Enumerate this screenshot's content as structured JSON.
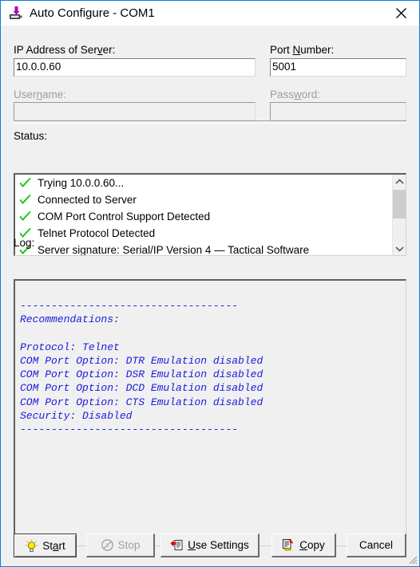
{
  "window": {
    "title": "Auto Configure - COM1",
    "title_icon": "serial-port-download-icon",
    "close_icon": "close-icon",
    "accent_color": "#0a7cd4",
    "background_color": "#f0f0f0"
  },
  "form": {
    "ip_label_before": "IP Address of Ser",
    "ip_label_accel": "v",
    "ip_label_after": "er:",
    "ip_value": "10.0.0.60",
    "port_label_before": "Port ",
    "port_label_accel": "N",
    "port_label_after": "umber:",
    "port_value": "5001",
    "username_label_before": "User",
    "username_label_accel": "n",
    "username_label_after": "ame:",
    "username_value": "",
    "password_label_before": "Pass",
    "password_label_accel": "w",
    "password_label_after": "ord:",
    "password_value": ""
  },
  "status": {
    "label": "Status:",
    "items": [
      {
        "icon": "green-check-icon",
        "text": "Trying 10.0.0.60..."
      },
      {
        "icon": "green-check-icon",
        "text": "Connected to Server"
      },
      {
        "icon": "green-check-icon",
        "text": "COM Port Control Support Detected"
      },
      {
        "icon": "green-check-icon",
        "text": "Telnet Protocol Detected"
      },
      {
        "icon": "green-check-icon",
        "text": "Server signature: Serial/IP Version 4 — Tactical Software"
      }
    ],
    "scroll_up_icon": "chevron-up-icon",
    "scroll_down_icon": "chevron-down-icon"
  },
  "log": {
    "label": "Log:",
    "text_color": "#1a1ae0",
    "lines": [
      "",
      "-----------------------------------",
      "Recommendations:",
      "",
      "Protocol: Telnet",
      "COM Port Option: DTR Emulation disabled",
      "COM Port Option: DSR Emulation disabled",
      "COM Port Option: DCD Emulation disabled",
      "COM Port Option: CTS Emulation disabled",
      "Security: Disabled",
      "-----------------------------------"
    ]
  },
  "buttons": {
    "start": {
      "label_before": "St",
      "label_accel": "a",
      "label_after": "rt",
      "icon": "lightbulb-icon",
      "state": "default"
    },
    "stop": {
      "label": "Stop",
      "icon": "stop-no-entry-icon",
      "state": "disabled"
    },
    "use_settings": {
      "label_before": "",
      "label_accel": "U",
      "label_after": "se Settings",
      "icon": "apply-settings-icon",
      "state": "enabled"
    },
    "copy": {
      "label_before": "",
      "label_accel": "C",
      "label_after": "opy",
      "icon": "copy-clipboard-icon",
      "state": "enabled"
    },
    "cancel": {
      "label": "Cancel",
      "state": "enabled"
    }
  }
}
